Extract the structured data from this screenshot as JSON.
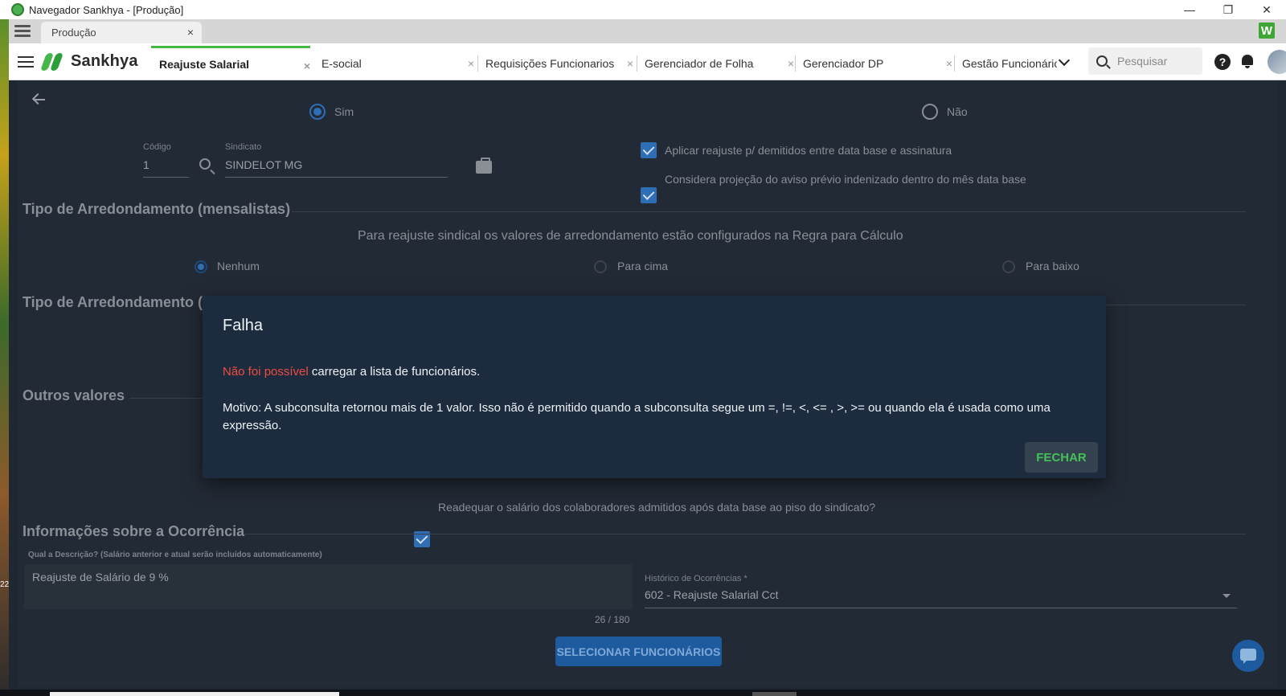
{
  "window": {
    "title": "Navegador Sankhya - [Produção]",
    "controls": [
      "—",
      "❐",
      "✕"
    ]
  },
  "browser_tab": {
    "label": "Produção",
    "close": "×"
  },
  "brand": {
    "name": "Sankhya",
    "color": "#45b649",
    "w_badge": "W"
  },
  "app_tabs": [
    {
      "label": "Reajuste Salarial",
      "active": true
    },
    {
      "label": "E-social"
    },
    {
      "label": "Requisições Funcionarios"
    },
    {
      "label": "Gerenciador de Folha"
    },
    {
      "label": "Gerenciador DP"
    },
    {
      "label": "Gestão Funcionário"
    }
  ],
  "tab_close": "×",
  "search": {
    "placeholder": "Pesquisar"
  },
  "help_glyph": "?",
  "form": {
    "radio_sim": "Sim",
    "radio_nao": "Não",
    "codigo_label": "Código",
    "codigo_value": "1",
    "sindicato_label": "Sindicato",
    "sindicato_value": "SINDELOT MG",
    "check1": "Aplicar reajuste p/ demitidos entre data base e assinatura",
    "check2": "Considera projeção do aviso prévio indenizado dentro do mês data base",
    "sect_arred_mens": "Tipo de Arredondamento (mensalistas)",
    "arred_note": "Para reajuste sindical os valores de arredondamento estão configurados na Regra para Cálculo",
    "opt_nenhum": "Nenhum",
    "opt_para_cima": "Para cima",
    "opt_para_baixo": "Para baixo",
    "sect_arred_2": "Tipo de Arredondamento (",
    "sect_outros": "Outros valores",
    "check3": "Readequar o salário dos colaboradores admitidos após data base ao piso do sindicato?",
    "sect_info": "Informações sobre a Ocorrência",
    "desc_label": "Qual a Descrição? (Salário anterior e atual serão incluídos automaticamente)",
    "desc_value": "Reajuste de Salário de 9 %",
    "char_count": "26 / 180",
    "historico_label": "Histórico de Ocorrências *",
    "historico_value": "602 - Reajuste Salarial Cct",
    "select_button": "SELECIONAR FUNCIONÁRIOS"
  },
  "modal": {
    "title": "Falha",
    "msg_error": "Não foi possível",
    "msg_rest": " carregar a lista de funcionários.",
    "reason": "Motivo: A subconsulta retornou mais de 1 valor. Isso não é permitido quando a subconsulta segue um =, !=, <, <= , >, >= ou quando ela é usada como uma expressão.",
    "close_button": "FECHAR"
  },
  "desktop_fragment": "22"
}
